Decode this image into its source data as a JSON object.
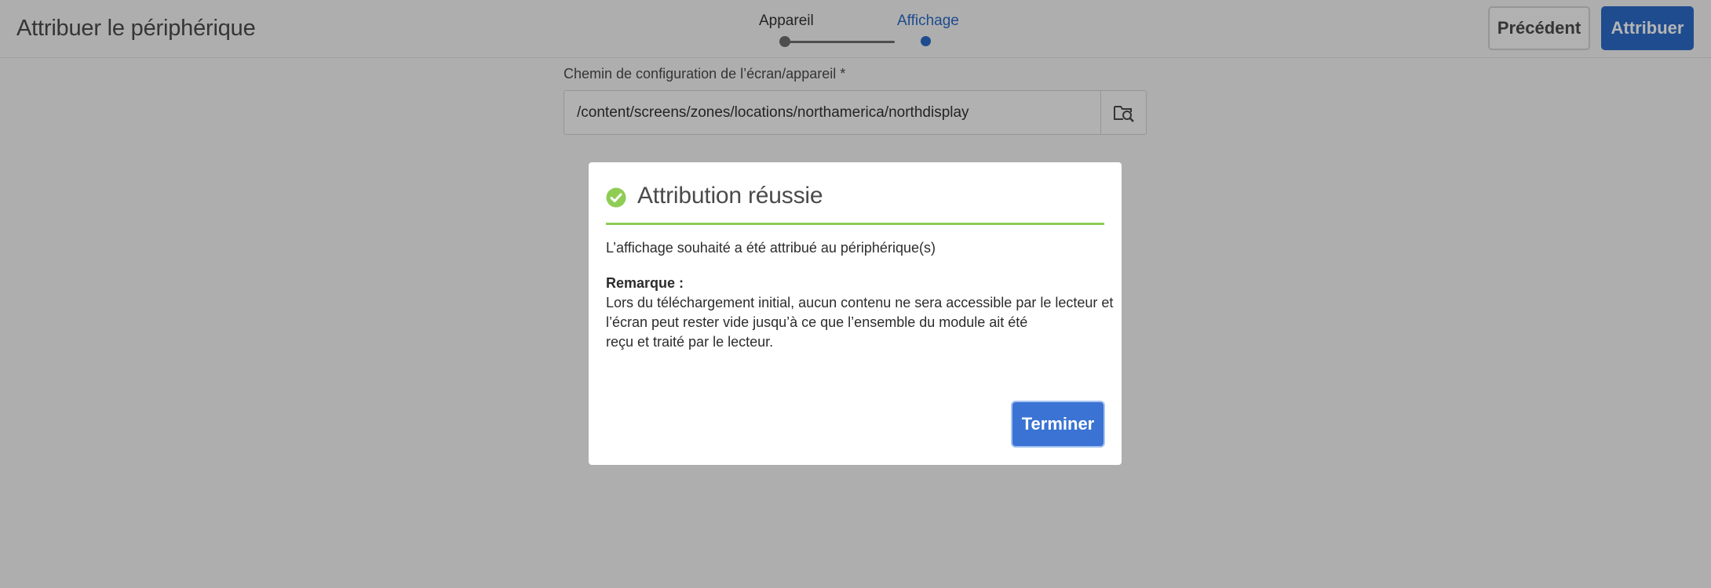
{
  "header": {
    "title": "Attribuer le périphérique",
    "steps": [
      {
        "label": "Appareil",
        "state": "done"
      },
      {
        "label": "Affichage",
        "state": "current"
      }
    ],
    "prev_button": "Précédent",
    "assign_button": "Attribuer"
  },
  "form": {
    "path_label": "Chemin de configuration de l’écran/appareil *",
    "path_value": "/content/screens/zones/locations/northamerica/northdisplay",
    "browse_icon": "folder-search-icon"
  },
  "dialog": {
    "title": "Attribution réussie",
    "status_icon": "check-circle-icon",
    "message": "L’affichage souhaité a été attribué au périphérique(s)",
    "note_label": "Remarque :",
    "note_lines": [
      "Lors du téléchargement initial, aucun contenu ne sera accessible par le lecteur et",
      "l’écran peut rester vide jusqu’à ce que l’ensemble du module ait été",
      "reçu et traité par le lecteur."
    ],
    "done_button": "Terminer"
  },
  "colors": {
    "accent": "#2c6bc9",
    "success": "#8fcc54",
    "overlay": "rgba(0,0,0,0.29)"
  }
}
